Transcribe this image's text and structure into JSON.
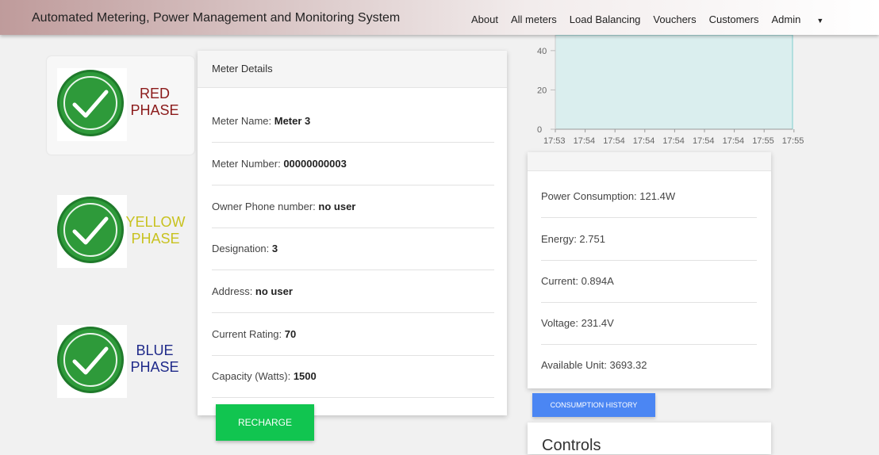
{
  "header": {
    "title": "Automated Metering, Power Management and Monitoring System",
    "nav": [
      "About",
      "All meters",
      "Load Balancing",
      "Vouchers",
      "Customers",
      "Admin"
    ]
  },
  "phases": [
    {
      "label_line1": "RED",
      "label_line2": "PHASE",
      "color": "#8b1a1a",
      "status": "ok"
    },
    {
      "label_line1": "YELLOW",
      "label_line2": "PHASE",
      "color": "#c8c21f",
      "status": "ok"
    },
    {
      "label_line1": "BLUE",
      "label_line2": "PHASE",
      "color": "#1f2a8a",
      "status": "ok"
    }
  ],
  "meter": {
    "header": "Meter Details",
    "rows": [
      {
        "label": "Meter Name: ",
        "value": "Meter 3"
      },
      {
        "label": "Meter Number: ",
        "value": "00000000003"
      },
      {
        "label": "Owner Phone number: ",
        "value": "no user"
      },
      {
        "label": "Designation: ",
        "value": "3"
      },
      {
        "label": "Address: ",
        "value": "no user"
      },
      {
        "label": "Current Rating: ",
        "value": "70"
      },
      {
        "label": "Capacity (Watts): ",
        "value": "1500"
      }
    ],
    "recharge_label": "RECHARGE"
  },
  "chart_data": {
    "type": "area",
    "categories": [
      "17:53",
      "17:54",
      "17:54",
      "17:54",
      "17:54",
      "17:54",
      "17:54",
      "17:55",
      "17:55"
    ],
    "y_ticks": [
      "0",
      "20",
      "40"
    ],
    "ylim": [
      0,
      48
    ],
    "fill_color": "#daeeee",
    "line_color": "#7fcfcf"
  },
  "readings": {
    "rows": [
      "Power Consumption: 121.4W",
      "Energy: 2.751",
      "Current: 0.894A",
      "Voltage: 231.4V",
      "Available Unit: 3693.32"
    ],
    "history_label": "CONSUMPTION HISTORY"
  },
  "controls": {
    "title": "Controls"
  },
  "colors": {
    "recharge": "#11c550",
    "history": "#4b86f3",
    "check": "#2e9a3a"
  }
}
